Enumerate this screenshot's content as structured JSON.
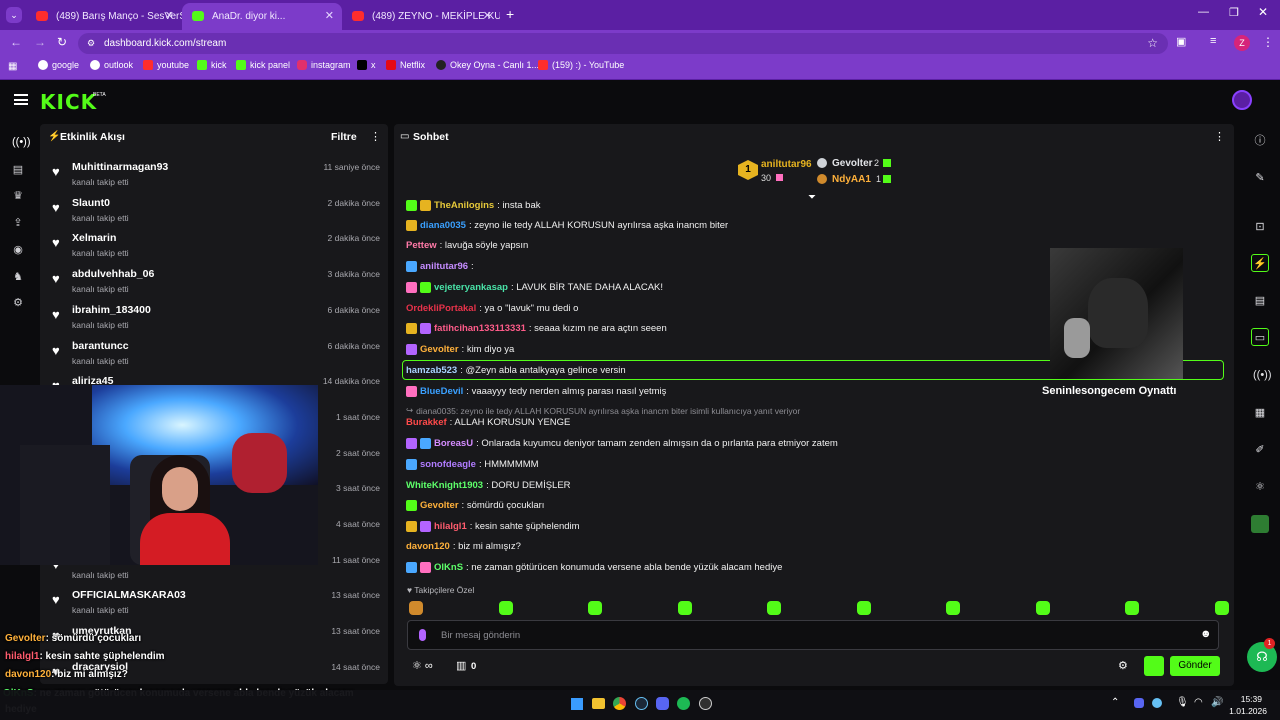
{
  "browser": {
    "tabs": [
      {
        "title": "(489) Barış Manço - SesVerSus |",
        "favicon": "#ff2d2d"
      },
      {
        "title": "AnaDr. diyor ki...",
        "favicon": "#53fc18"
      },
      {
        "title": "(489) ZEYNO - MEKİPLE KURAB",
        "favicon": "#ff2d2d"
      }
    ],
    "url": "dashboard.kick.com/stream",
    "profile_initial": "Z",
    "bookmarks": [
      "google",
      "outlook",
      "youtube",
      "kick",
      "kick panel",
      "instagram",
      "x",
      "Netflix",
      "Okey Oyna - Canlı 1...",
      "(159) :) - YouTube"
    ]
  },
  "header": {
    "logo": "KICK",
    "beta": "BETA"
  },
  "activity": {
    "title": "Etkinlik Akışı",
    "filter_label": "Filtre",
    "items": [
      {
        "user": "Muhittinarmagan93",
        "action": "kanalı takip etti",
        "time": "11 saniye önce"
      },
      {
        "user": "Slaunt0",
        "action": "kanalı takip etti",
        "time": "2 dakika önce"
      },
      {
        "user": "Xelmarin",
        "action": "kanalı takip etti",
        "time": "2 dakika önce"
      },
      {
        "user": "abdulvehhab_06",
        "action": "kanalı takip etti",
        "time": "3 dakika önce"
      },
      {
        "user": "ibrahim_183400",
        "action": "kanalı takip etti",
        "time": "6 dakika önce"
      },
      {
        "user": "barantuncc",
        "action": "kanalı takip etti",
        "time": "6 dakika önce"
      },
      {
        "user": "aliriza45",
        "action": "",
        "time": "14 dakika önce"
      },
      {
        "user": "",
        "action": "",
        "time": "1 saat önce"
      },
      {
        "user": "",
        "action": "",
        "time": "2 saat önce"
      },
      {
        "user": "",
        "action": "",
        "time": "3 saat önce"
      },
      {
        "user": "",
        "action": "",
        "time": "4 saat önce"
      },
      {
        "user": "",
        "action": "kanalı takip etti",
        "time": "11 saat önce"
      },
      {
        "user": "OFFICIALMASKARA03",
        "action": "kanalı takip etti",
        "time": "13 saat önce"
      },
      {
        "user": "umeyrutkan",
        "action": "",
        "time": "13 saat önce"
      },
      {
        "user": "dracarysiol",
        "action": "",
        "time": "14 saat önce"
      }
    ]
  },
  "chat": {
    "title": "Sohbet",
    "pinned": {
      "top": {
        "user": "aniltutar96",
        "count": "30"
      },
      "second": {
        "user": "Gevolter",
        "count": "2"
      },
      "third": {
        "user": "NdyAA1",
        "count": "1"
      }
    },
    "messages": [
      {
        "user": "TheAnilogins",
        "color": "#e6c93a",
        "text": ": insta bak"
      },
      {
        "user": "diana0035",
        "color": "#3aa0ff",
        "text": ": zeyno ile tedy ALLAH KORUSUN ayrılırsa aşka inancm biter"
      },
      {
        "user": "Pettew",
        "color": "#ff7aa8",
        "text": ": lavuğa söyle yapsın"
      },
      {
        "user": "aniltutar96",
        "color": "#c58cff",
        "text": ": "
      },
      {
        "user": "vejeteryankasap",
        "color": "#49e3a8",
        "text": ": LAVUK BİR TANE DAHA ALACAK!"
      },
      {
        "user": "OrdekliPortakal",
        "color": "#e8324a",
        "text": ": ya o \"lavuk\" mu dedi o"
      },
      {
        "user": "fatihcihan133113331",
        "color": "#ff5c8a",
        "text": ": seaaa kızım ne ara açtın seeen"
      },
      {
        "user": "Gevolter",
        "color": "#ffb13b",
        "text": ": kim diyo ya"
      },
      {
        "user": "hamzab523",
        "color": "#a9d3ff",
        "text": ": @Zeyn abla antalkyaya gelince versin"
      },
      {
        "user": "BlueDevil",
        "color": "#3aa0ff",
        "text": ": vaaayyy tedy nerden almış parası nasıl yetmiş"
      },
      {
        "reply": "diana0035: zeyno ile tedy ALLAH KORUSUN ayrılırsa aşka inancm biter isimli kullanıcıya yanıt veriyor"
      },
      {
        "user": "Burakkef",
        "color": "#ff4a4a",
        "text": ": ALLAH KORUSUN YENGE"
      },
      {
        "user": "BoreasU",
        "color": "#d48cff",
        "text": ": Onlarada kuyumcu deniyor tamam zenden almışsın da o pırlanta para etmiyor zatem"
      },
      {
        "user": "sonofdeagle",
        "color": "#b07cff",
        "text": ": HMMMMMM"
      },
      {
        "user": "WhiteKnight1903",
        "color": "#5dff6a",
        "text": ": DORU DEMİŞLER"
      },
      {
        "user": "Gevolter",
        "color": "#ffb13b",
        "text": ": sömürdü çocukları"
      },
      {
        "user": "hilalgl1",
        "color": "#ff5c6e",
        "text": ": kesin sahte şüphelendim"
      },
      {
        "user": "davon120",
        "color": "#ffb13b",
        "text": ": biz mi almışız?"
      },
      {
        "user": "OlKnS",
        "color": "#5dff6a",
        "text": ": ne zaman götürücen konumuda versene abla bende yüzük alacam hediye"
      }
    ],
    "followers_only": "Takipçilere Özel",
    "input_placeholder": "Bir mesaj gönderin",
    "points": "0",
    "send_label": "Gönder",
    "overlay_caption": "Seninlesongecem Oynattı"
  },
  "stream_overlay": {
    "lines": [
      {
        "user": "Gevolter",
        "text": ": sömürdü çocukları"
      },
      {
        "user": "hilalgl1",
        "text": ": kesin sahte şüphelendim"
      },
      {
        "user": "davon120",
        "text": ": biz mi almışız?"
      },
      {
        "user": "OlKnS",
        "text": ": ne zaman götürücen konumuda versene abla bende yüzük alacam"
      },
      {
        "user": "",
        "text": "hediye"
      }
    ]
  },
  "taskbar": {
    "time": "15:39",
    "date": "1.01.2026"
  },
  "notification_count": "1"
}
